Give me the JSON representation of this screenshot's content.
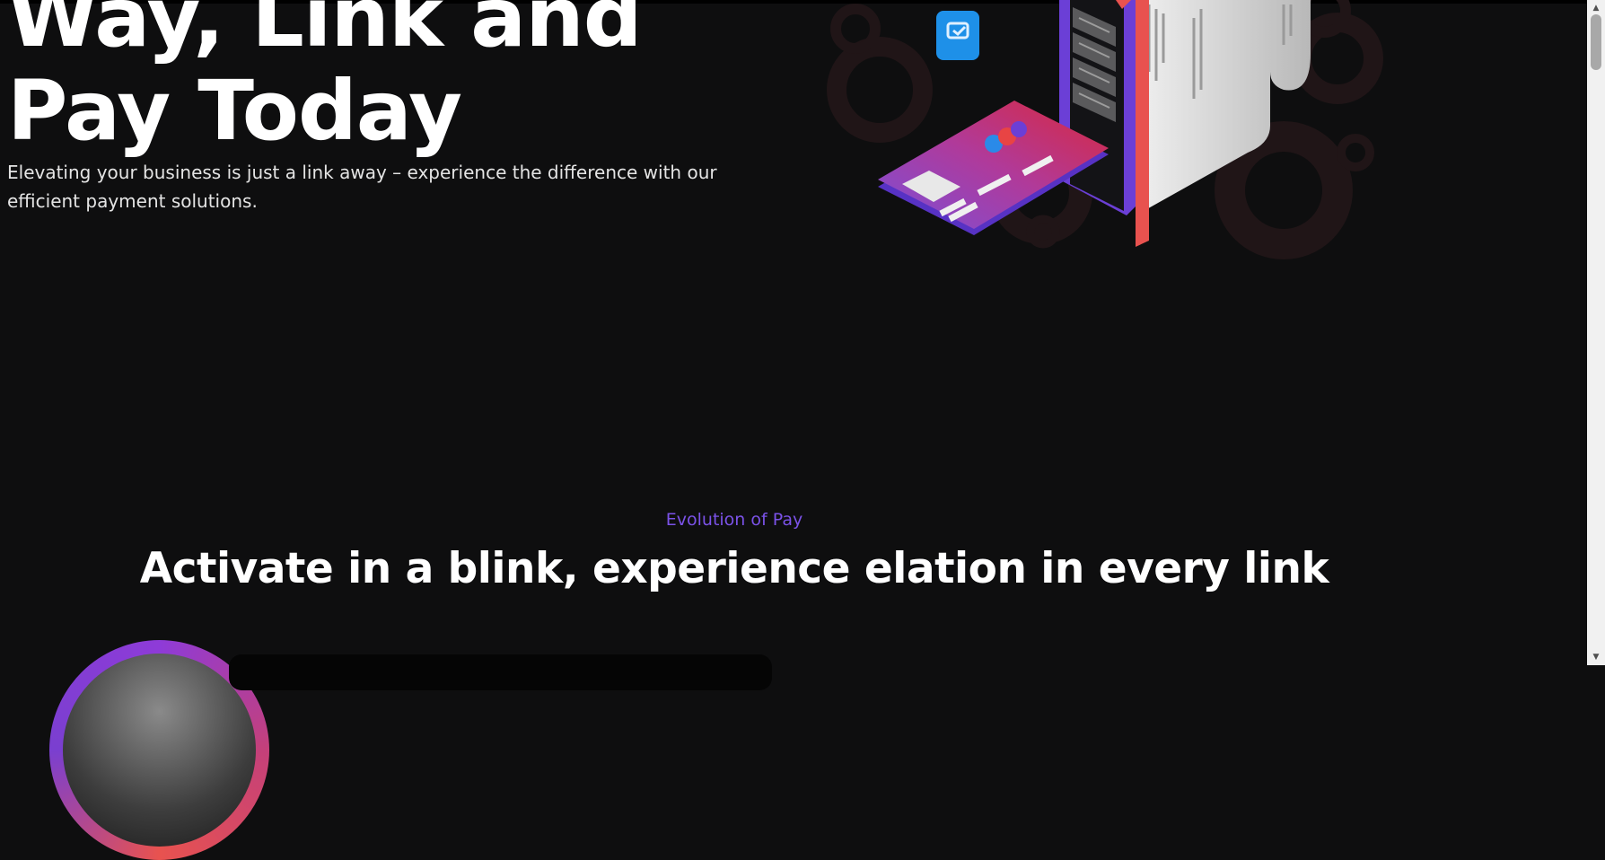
{
  "hero": {
    "title_line1": "Way, Link and",
    "title_line2": "Pay Today",
    "subtitle_line1": "Elevating your business is just a link away – experience the difference with our",
    "subtitle_line2": "efficient payment solutions."
  },
  "illustration": {
    "icon_name": "payment-phone-card-receipt-illustration"
  },
  "section": {
    "eyebrow": "Evolution of Pay",
    "title": "Activate in a blink, experience elation in every link"
  },
  "colors": {
    "background": "#0e0e0f",
    "accent_purple": "#7b52e8",
    "accent_red": "#e8524f",
    "phone_purple": "#6b3fd6",
    "phone_blue_badge": "#1e90e8"
  },
  "scrollbar": {
    "up_icon": "triangle-up-icon",
    "down_icon": "triangle-down-icon"
  }
}
